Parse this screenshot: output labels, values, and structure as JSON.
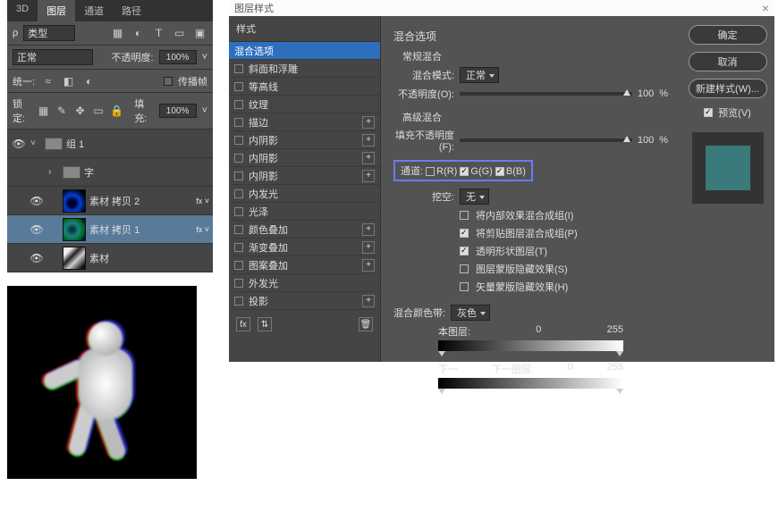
{
  "panel": {
    "tabs": [
      "3D",
      "图层",
      "通道",
      "路径"
    ],
    "active_tab": 1,
    "kind_label": "类型",
    "blend_mode": "正常",
    "opacity_label": "不透明度:",
    "opacity_value": "100%",
    "lock_label": "锁定:",
    "fill_label_prefix": "统一:",
    "propagate_label": "传播帧",
    "fill_label": "填充:",
    "fill_value": "100%"
  },
  "layers": [
    {
      "eye": "👁",
      "type": "group",
      "name": "组 1",
      "open": true
    },
    {
      "eye": "",
      "type": "group",
      "name": "字",
      "indent": 1
    },
    {
      "eye": "👁",
      "type": "layer",
      "name": "素材 拷贝 2",
      "thumb": "blue",
      "fx": true,
      "indent": 1
    },
    {
      "eye": "👁",
      "type": "layer",
      "name": "素材 拷贝 1",
      "thumb": "cyan",
      "fx": true,
      "indent": 1,
      "selected": true
    },
    {
      "eye": "👁",
      "type": "layer",
      "name": "素材",
      "thumb": "bw",
      "indent": 1
    }
  ],
  "dialog": {
    "title": "图层样式",
    "left_header": "样式",
    "effects": [
      {
        "label": "混合选项",
        "selected": true
      },
      {
        "label": "斜面和浮雕"
      },
      {
        "label": "等高线"
      },
      {
        "label": "纹理"
      },
      {
        "label": "描边",
        "plus": true
      },
      {
        "label": "内阴影",
        "plus": true
      },
      {
        "label": "内阴影",
        "plus": true
      },
      {
        "label": "内阴影",
        "plus": true
      },
      {
        "label": "内发光"
      },
      {
        "label": "光泽"
      },
      {
        "label": "颜色叠加",
        "plus": true
      },
      {
        "label": "渐变叠加",
        "plus": true
      },
      {
        "label": "图案叠加",
        "plus": true
      },
      {
        "label": "外发光"
      },
      {
        "label": "投影",
        "plus": true
      }
    ],
    "mid": {
      "section": "混合选项",
      "general": "常规混合",
      "blend_mode_label": "混合模式:",
      "blend_mode_value": "正常",
      "opacity_label": "不透明度(O):",
      "opacity_value": "100",
      "pct": "%",
      "advanced": "高级混合",
      "fill_opacity_label": "填充不透明度(F):",
      "fill_opacity_value": "100",
      "channels_label": "通道:",
      "ch_r": "R(R)",
      "ch_g": "G(G)",
      "ch_b": "B(B)",
      "knockout_label": "挖空:",
      "knockout_value": "无",
      "opt1": "将内部效果混合成组(I)",
      "opt2": "将剪贴图层混合成组(P)",
      "opt3": "透明形状图层(T)",
      "opt4": "图层蒙版隐藏效果(S)",
      "opt5": "矢量蒙版隐藏效果(H)",
      "blend_if_label": "混合颜色带:",
      "blend_if_value": "灰色",
      "this_layer": "本图层:",
      "under_layer": "下一图层:",
      "num0": "0",
      "num255": "255"
    },
    "right": {
      "ok": "确定",
      "cancel": "取消",
      "new_style": "新建样式(W)...",
      "preview": "预览(V)"
    }
  }
}
